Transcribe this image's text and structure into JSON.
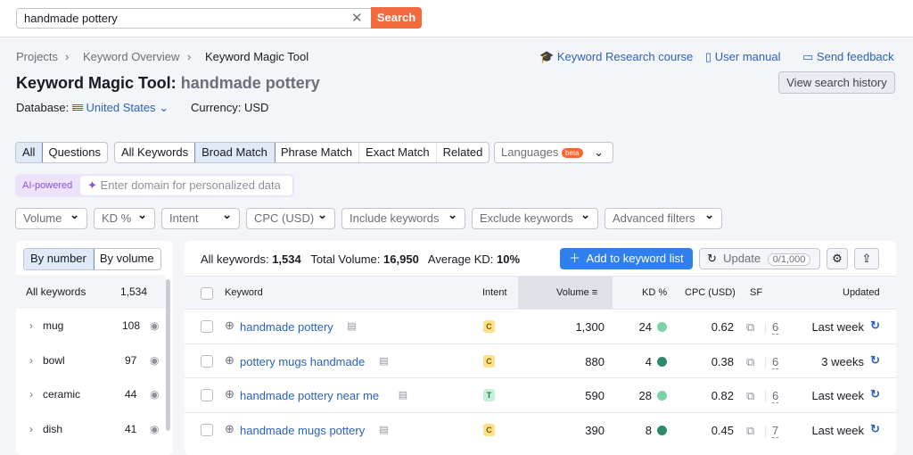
{
  "search": {
    "value": "handmade pottery",
    "button": "Search"
  },
  "breadcrumb": [
    "Projects",
    "Keyword Overview",
    "Keyword Magic Tool"
  ],
  "header_links": [
    "Keyword Research course",
    "User manual",
    "Send feedback"
  ],
  "title": {
    "tool": "Keyword Magic Tool:",
    "query": "handmade pottery"
  },
  "view_history": "View search history",
  "database": {
    "label": "Database:",
    "value": "United States"
  },
  "currency": "Currency: USD",
  "tabs1": [
    "All",
    "Questions"
  ],
  "tabs2": [
    "All Keywords",
    "Broad Match",
    "Phrase Match",
    "Exact Match",
    "Related"
  ],
  "languages": {
    "label": "Languages",
    "badge": "beta"
  },
  "ai": {
    "label": "AI-powered",
    "placeholder": "Enter domain for personalized data"
  },
  "filters": [
    "Volume",
    "KD %",
    "Intent",
    "CPC (USD)",
    "Include keywords",
    "Exclude keywords",
    "Advanced filters"
  ],
  "left": {
    "toggle": [
      "By number",
      "By volume"
    ],
    "header": [
      "All keywords",
      "1,534"
    ],
    "groups": [
      {
        "name": "mug",
        "count": "108"
      },
      {
        "name": "bowl",
        "count": "97"
      },
      {
        "name": "ceramic",
        "count": "44"
      },
      {
        "name": "dish",
        "count": "41"
      }
    ]
  },
  "summary": {
    "all_label": "All keywords:",
    "all": "1,534",
    "vol_label": "Total Volume:",
    "vol": "16,950",
    "kd_label": "Average KD:",
    "kd": "10%"
  },
  "add_button": "Add to keyword list",
  "update": {
    "label": "Update",
    "count": "0/1,000"
  },
  "columns": [
    "Keyword",
    "Intent",
    "Volume",
    "KD %",
    "CPC (USD)",
    "SF",
    "Updated"
  ],
  "rows": [
    {
      "keyword": "handmade pottery",
      "intent": "C",
      "volume": "1,300",
      "kd": "24",
      "cpc": "0.62",
      "sf": "6",
      "updated": "Last week",
      "kd_color": "#7dd3a8"
    },
    {
      "keyword": "pottery mugs handmade",
      "intent": "C",
      "volume": "880",
      "kd": "4",
      "cpc": "0.38",
      "sf": "6",
      "updated": "3 weeks",
      "kd_color": "#2e8b6a"
    },
    {
      "keyword": "handmade pottery near me",
      "intent": "T",
      "volume": "590",
      "kd": "28",
      "cpc": "0.82",
      "sf": "6",
      "updated": "Last week",
      "kd_color": "#7dd3a8"
    },
    {
      "keyword": "handmade mugs pottery",
      "intent": "C",
      "volume": "390",
      "kd": "8",
      "cpc": "0.45",
      "sf": "7",
      "updated": "Last week",
      "kd_color": "#2e8b6a"
    }
  ]
}
